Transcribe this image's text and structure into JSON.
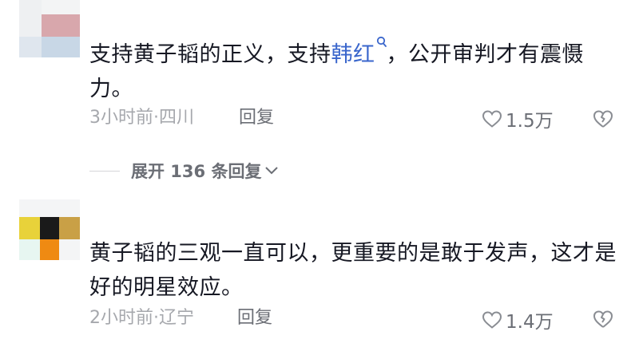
{
  "comments": [
    {
      "text_before": "支持黄子韬的正义，支持",
      "mention": "韩红",
      "text_after": "，公开审判才有震慑力。",
      "time": "3小时前",
      "location": "四川",
      "reply_label": "回复",
      "likes": "1.5万",
      "expand_label": "展开 136 条回复"
    },
    {
      "text_before": "黄子韬的三观一直可以，更重要的是敢于发声，这才是好的明星效应。",
      "mention": "",
      "text_after": "",
      "time": "2小时前",
      "location": "辽宁",
      "reply_label": "回复",
      "likes": "1.4万"
    }
  ],
  "colors": {
    "text": "#161823",
    "mention": "#3a66cc",
    "meta": "#a6a8ad",
    "action": "#6b6e75"
  },
  "icons": [
    "search-icon",
    "heart-icon",
    "broken-heart-icon",
    "chevron-down-icon"
  ]
}
